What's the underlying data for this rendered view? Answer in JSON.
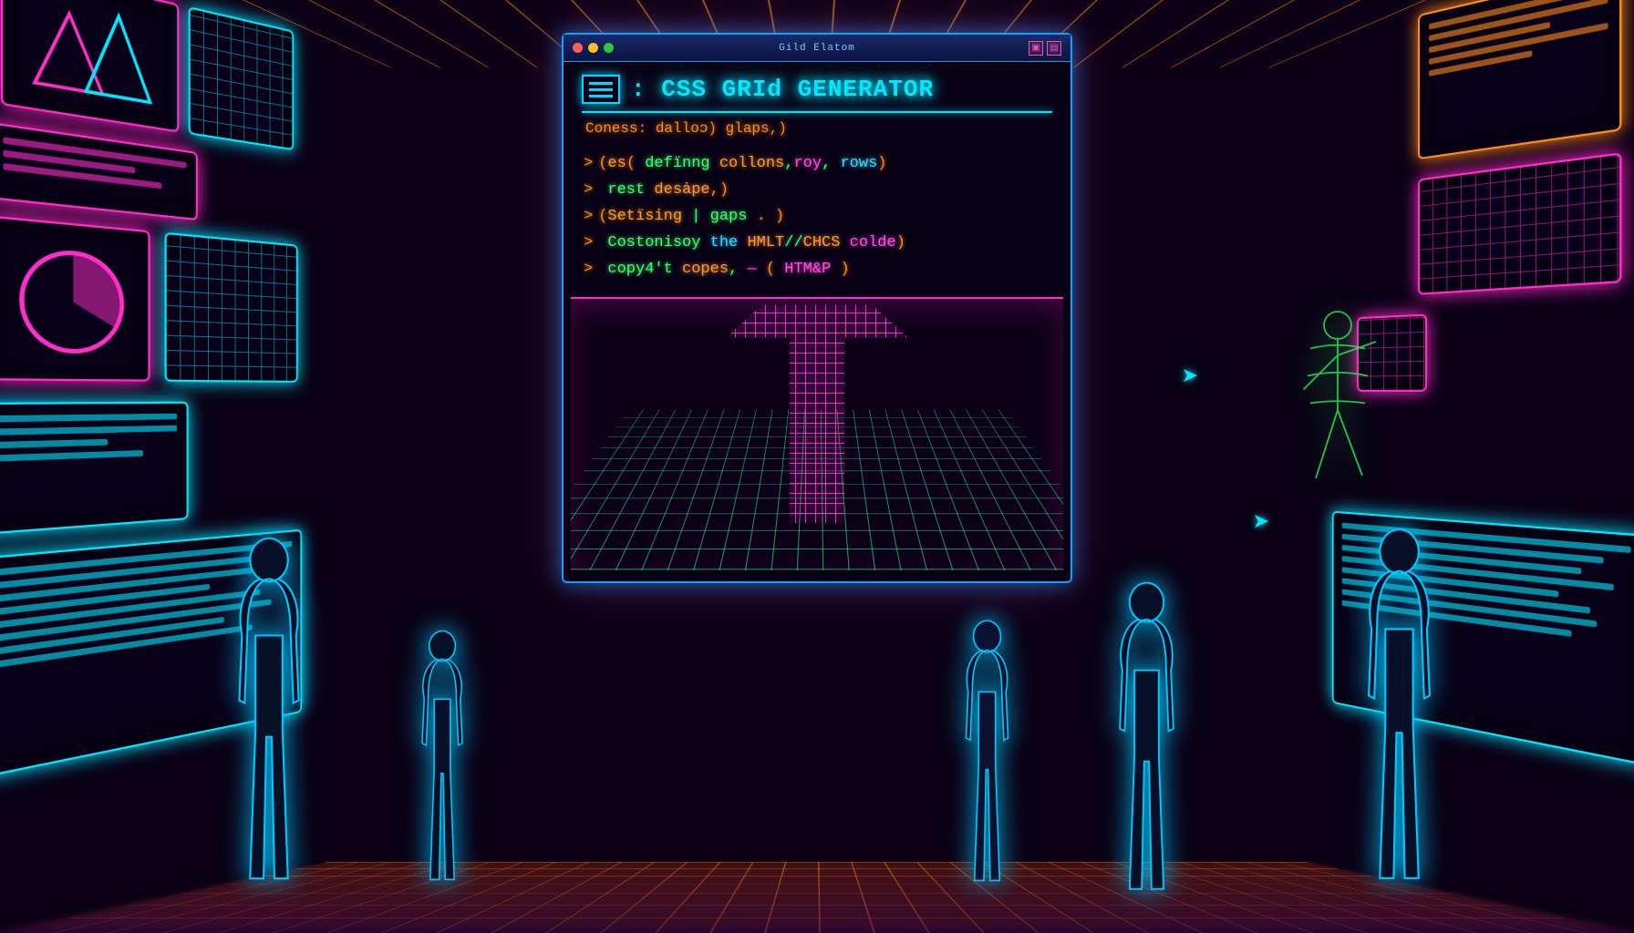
{
  "window": {
    "titlebar_text": "Gild Elatom",
    "heading": ": CSS GRId GENERATOR",
    "subline": "Coness: dalloɔ)  glaps,)",
    "lines": [
      {
        "prompt": ">",
        "segments": [
          {
            "t": "(",
            "c": "paren"
          },
          {
            "t": "es",
            "c": "c-orange"
          },
          {
            "t": "( ",
            "c": "paren"
          },
          {
            "t": "defïnng ",
            "c": "c-green"
          },
          {
            "t": "collons",
            "c": "c-orange"
          },
          {
            "t": ",",
            "c": "c-green"
          },
          {
            "t": "roy",
            "c": "c-magenta"
          },
          {
            "t": ", ",
            "c": "c-green"
          },
          {
            "t": "rows",
            "c": "c-cyan"
          },
          {
            "t": ")",
            "c": "paren"
          }
        ]
      },
      {
        "prompt": ">",
        "segments": [
          {
            "t": " rest ",
            "c": "c-green"
          },
          {
            "t": "desȧpe",
            "c": "c-orange"
          },
          {
            "t": ",)",
            "c": "paren"
          }
        ]
      },
      {
        "prompt": ">",
        "segments": [
          {
            "t": "(",
            "c": "paren"
          },
          {
            "t": "Setïsing ",
            "c": "c-orange"
          },
          {
            "t": "| gaps ",
            "c": "c-green"
          },
          {
            "t": ". )",
            "c": "paren"
          }
        ]
      },
      {
        "prompt": ">",
        "segments": [
          {
            "t": " Costonisoy ",
            "c": "c-green"
          },
          {
            "t": "the ",
            "c": "c-cyan"
          },
          {
            "t": "HMLT",
            "c": "c-orange"
          },
          {
            "t": "//",
            "c": "c-green"
          },
          {
            "t": "CHCS ",
            "c": "c-orange"
          },
          {
            "t": "colde",
            "c": "c-magenta"
          },
          {
            "t": ")",
            "c": "paren"
          }
        ]
      },
      {
        "prompt": ">",
        "segments": [
          {
            "t": " copy4't ",
            "c": "c-green"
          },
          {
            "t": "copes",
            "c": "c-orange"
          },
          {
            "t": ", ",
            "c": "c-green"
          },
          {
            "t": "—",
            "c": "c-magenta"
          },
          {
            "t": " ( ",
            "c": "paren"
          },
          {
            "t": "HTM&P",
            "c": "c-magenta"
          },
          {
            "t": " )",
            "c": "paren"
          }
        ]
      }
    ]
  }
}
